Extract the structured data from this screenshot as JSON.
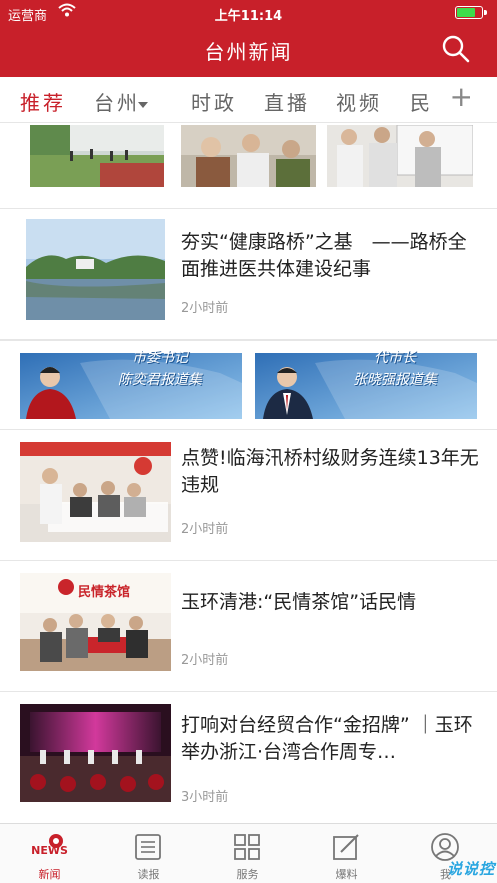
{
  "status_bar": {
    "carrier": "运营商",
    "time": "上午11:14"
  },
  "header": {
    "title": "台州新闻"
  },
  "tabs": [
    {
      "label": "推荐",
      "active": true
    },
    {
      "label": "台州",
      "dropdown": true
    },
    {
      "label": "时政"
    },
    {
      "label": "直播"
    },
    {
      "label": "视频"
    },
    {
      "label": "民"
    }
  ],
  "add_tab": "+",
  "news": [
    {
      "title": "夯实“健康路桥”之基　——路桥全面推进医共体建设纪事",
      "time": "2小时前"
    },
    {
      "title": "点赞!临海汛桥村级财务连续13年无违规",
      "time": "2小时前"
    },
    {
      "title": "玉环清港:“民情茶馆”话民情",
      "time": "2小时前",
      "image_sign": "民情茶馆"
    },
    {
      "title": "打响对台经贸合作“金招牌” ｜玉环举办浙江·台湾合作周专…",
      "time": "3小时前"
    }
  ],
  "banners": [
    {
      "line1": "市委书记",
      "line2": "陈奕君报道集"
    },
    {
      "line1": "代市长",
      "line2": "张晓强报道集"
    }
  ],
  "bottom_nav": [
    {
      "label": "新闻",
      "icon": "news-icon",
      "icon_text": "NEWS",
      "active": true
    },
    {
      "label": "读报",
      "icon": "newspaper-icon"
    },
    {
      "label": "服务",
      "icon": "grid-icon"
    },
    {
      "label": "爆料",
      "icon": "edit-icon"
    },
    {
      "label": "我",
      "icon": "user-icon"
    }
  ],
  "watermark": "说说控",
  "colors": {
    "brand": "#c8202a",
    "tab_inactive": "#666666",
    "time_text": "#999999"
  }
}
